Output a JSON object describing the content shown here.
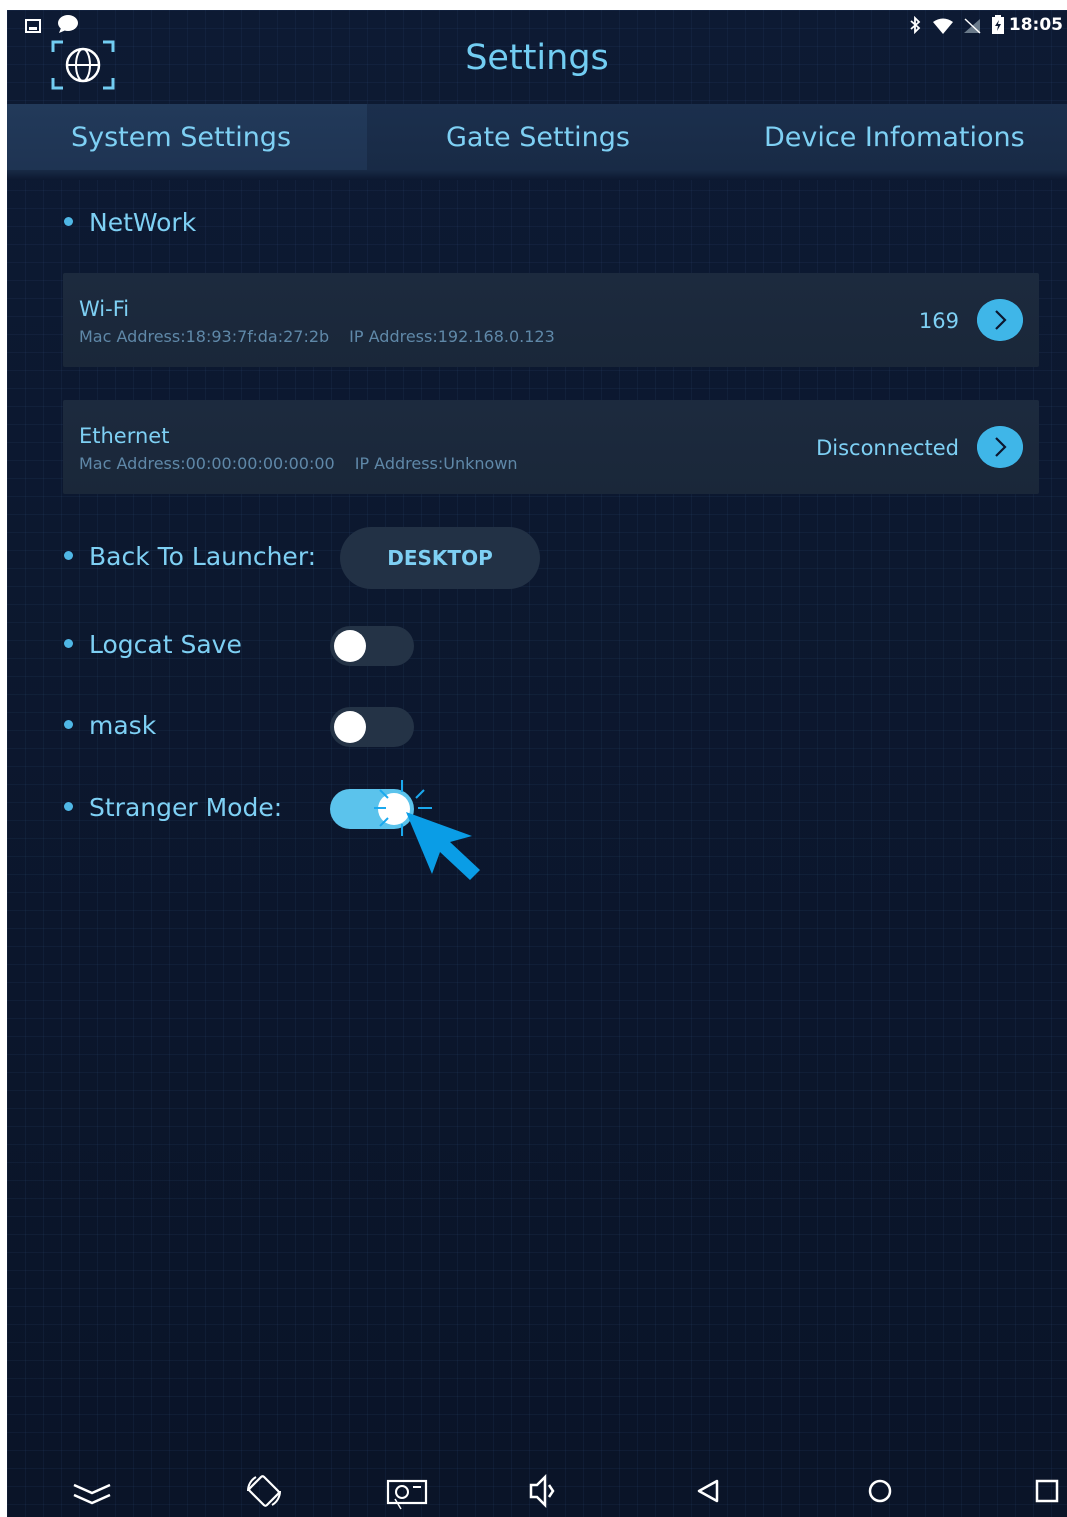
{
  "status_bar": {
    "time": "18:05",
    "icons": [
      "picture-icon",
      "chat-bubble-icon",
      "bluetooth-icon",
      "wifi-icon",
      "no-sim-icon",
      "battery-icon"
    ]
  },
  "header": {
    "title": "Settings",
    "logo_icon": "face-scan-logo-icon"
  },
  "tabs": [
    {
      "label": "System Settings",
      "active": true
    },
    {
      "label": "Gate Settings",
      "active": false
    },
    {
      "label": "Device Infomations",
      "active": false
    }
  ],
  "network": {
    "section_label": "NetWork",
    "wifi": {
      "title": "Wi-Fi",
      "mac": "Mac Address:18:93:7f:da:27:2b",
      "ip": "IP Address:192.168.0.123",
      "value": "169"
    },
    "ethernet": {
      "title": "Ethernet",
      "mac": "Mac Address:00:00:00:00:00:00",
      "ip": "IP Address:Unknown",
      "value": "Disconnected"
    }
  },
  "launcher": {
    "label": "Back To Launcher:",
    "button": "DESKTOP"
  },
  "logcat": {
    "label": "Logcat Save",
    "on": false
  },
  "mask": {
    "label": "mask",
    "on": false
  },
  "stranger": {
    "label": "Stranger Mode:",
    "on": true
  },
  "colors": {
    "accent": "#72cdf2",
    "toggle_on": "#5bc3ec",
    "background": "#0c1830",
    "cursor": "#0a9de6"
  },
  "nav_bar": {
    "icons": [
      "keyboard-hide-icon",
      "screen-rotate-icon",
      "screenshot-icon",
      "volume-icon",
      "back-icon",
      "home-icon",
      "recents-icon"
    ]
  }
}
